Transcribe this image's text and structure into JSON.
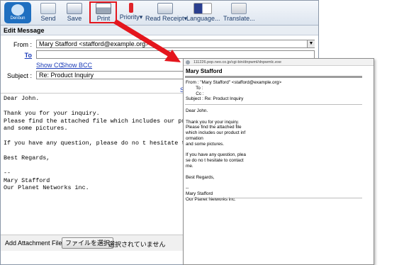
{
  "toolbar": {
    "logo_text": "Denbun",
    "buttons": [
      {
        "label": "Send",
        "icon": "send-icon"
      },
      {
        "label": "Save",
        "icon": "save-icon"
      },
      {
        "label": "Print",
        "icon": "printer-icon"
      },
      {
        "label": "Priority",
        "icon": "priority-icon"
      },
      {
        "label": "Read Receipt",
        "icon": "read-receipt-icon"
      },
      {
        "label": "Language...",
        "icon": "language-flags-icon"
      },
      {
        "label": "Translate...",
        "icon": "translate-icon"
      }
    ]
  },
  "section_title": "Edit Message",
  "form": {
    "from_label": "From :",
    "from_value": "Mary Stafford <stafford@example.org>",
    "to_label": "To",
    "to_value": "",
    "show_cc": "Show CC",
    "show_bcc": "Show BCC",
    "subject_label": "Subject :",
    "subject_value": "Re: Product Inquiry",
    "side_link": "Se"
  },
  "body_lines": "Dear John.\n\nThank you for your inquiry.\nPlease find the attached file which includes our product\nand some pictures.\n\nIf you have any question, please do no t hesitate to co\n\nBest Regards,\n\n--\nMary Stafford\nOur Planet Networks inc.",
  "attachment": {
    "label": "Add Attachment File :",
    "button": "ファイルを選択",
    "status": "選択されていません"
  },
  "popup": {
    "url": "111226.pop.neo.co.jp/cgi-bin/dnpwml/dnpwmlc.exe",
    "title": "Mary Stafford",
    "header_lines": "From : \"Mary Stafford\" <stafford@example.org>\n        To :\n        Cc :\nSubject : Re: Product Inquiry",
    "body_lines": "Dear John.\n\nThank you for your inquiry.\nPlease find the attached file\nwhich includes our product inf\normation\nand some pictures.\n\nIf you have any question, plea\nse do no t hesitate to contact\nme.\n\nBest Regards,\n\n--\nMary Stafford\nOur Planet Networks inc."
  },
  "colors": {
    "highlight": "#e4161d",
    "link": "#1a3bb8",
    "toolbar_text": "#1d3c6b"
  }
}
